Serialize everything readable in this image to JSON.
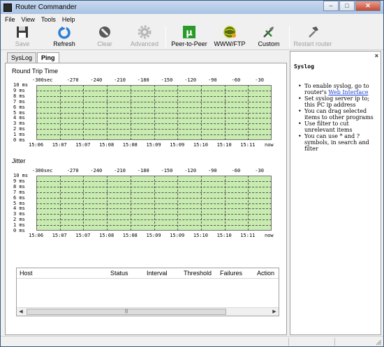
{
  "window": {
    "title": "Router Commander",
    "min_label": "–",
    "max_label": "□",
    "close_label": "✕"
  },
  "menu": [
    "File",
    "View",
    "Tools",
    "Help"
  ],
  "toolbar": {
    "save": "Save",
    "refresh": "Refresh",
    "clear": "Clear",
    "advanced": "Advanced",
    "p2p": "Peer-to-Peer",
    "www": "WWW/FTP",
    "custom": "Custom",
    "restart": "Restart router"
  },
  "tabs": {
    "syslog": "SysLog",
    "ping": "Ping"
  },
  "charts": {
    "rtt_title": "Round Trip Time",
    "jitter_title": "Jitter",
    "y_ticks": [
      "10 ms",
      "9 ms",
      "8 ms",
      "7 ms",
      "6 ms",
      "5 ms",
      "4 ms",
      "3 ms",
      "2 ms",
      "1 ms",
      "0 ms"
    ],
    "top_ticks": [
      "-300sec",
      "-270",
      "-240",
      "-210",
      "-180",
      "-150",
      "-120",
      "-90",
      "-60",
      "-30"
    ],
    "bottom_ticks": [
      "15:06",
      "15:07",
      "15:07",
      "15:08",
      "15:08",
      "15:09",
      "15:09",
      "15:10",
      "15:10",
      "15:11",
      "now"
    ]
  },
  "table": {
    "columns": [
      "Host",
      "Status",
      "Interval",
      "Threshold",
      "Failures",
      "Action"
    ],
    "rows": [],
    "scroll_grip": "|||"
  },
  "syslog_panel": {
    "close_label": "×",
    "title": "Syslog",
    "tip1_pre": "To enable syslog, go to router's ",
    "tip1_link": "Web Interface",
    "tip2": "Set syslog server ip to; this PC ip address",
    "tip3": "You can drag selected items to other programs",
    "tip4": "Use filter to cut unrelevant items",
    "tip5": "You can use * and ? symbols, in search and filter"
  },
  "colors": {
    "plot_bg": "#c8ecb0",
    "grid": "#555555",
    "link": "#1a3fd0"
  },
  "chart_data": [
    {
      "type": "line",
      "title": "Round Trip Time",
      "x_top": [
        "-300sec",
        "-270",
        "-240",
        "-210",
        "-180",
        "-150",
        "-120",
        "-90",
        "-60",
        "-30"
      ],
      "x_bottom": [
        "15:06",
        "15:07",
        "15:07",
        "15:08",
        "15:08",
        "15:09",
        "15:09",
        "15:10",
        "15:10",
        "15:11",
        "now"
      ],
      "ylim": [
        0,
        10
      ],
      "yunit": "ms",
      "series": [],
      "grid": true
    },
    {
      "type": "line",
      "title": "Jitter",
      "x_top": [
        "-300sec",
        "-270",
        "-240",
        "-210",
        "-180",
        "-150",
        "-120",
        "-90",
        "-60",
        "-30"
      ],
      "x_bottom": [
        "15:06",
        "15:07",
        "15:07",
        "15:08",
        "15:08",
        "15:09",
        "15:09",
        "15:10",
        "15:10",
        "15:11",
        "now"
      ],
      "ylim": [
        0,
        10
      ],
      "yunit": "ms",
      "series": [],
      "grid": true
    }
  ]
}
